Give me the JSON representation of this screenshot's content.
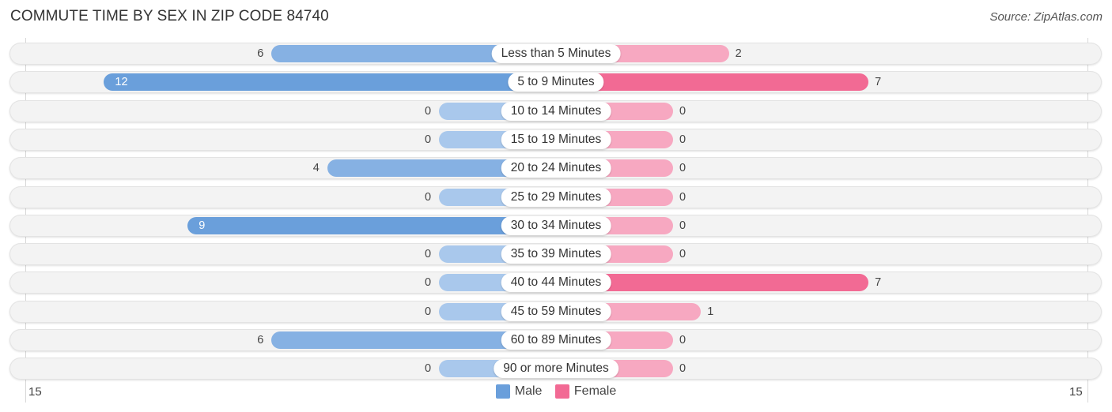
{
  "header": {
    "title": "COMMUTE TIME BY SEX IN ZIP CODE 84740",
    "source": "Source: ZipAtlas.com"
  },
  "colors": {
    "male_strong": "#6a9fdb",
    "male_light": "#a9c8ec",
    "female_strong": "#f26a94",
    "female_light": "#f7a8c1"
  },
  "chart_data": {
    "type": "bar",
    "orientation": "horizontal-diverging",
    "title": "COMMUTE TIME BY SEX IN ZIP CODE 84740",
    "categories": [
      "Less than 5 Minutes",
      "5 to 9 Minutes",
      "10 to 14 Minutes",
      "15 to 19 Minutes",
      "20 to 24 Minutes",
      "25 to 29 Minutes",
      "30 to 34 Minutes",
      "35 to 39 Minutes",
      "40 to 44 Minutes",
      "45 to 59 Minutes",
      "60 to 89 Minutes",
      "90 or more Minutes"
    ],
    "series": [
      {
        "name": "Male",
        "values": [
          6,
          12,
          0,
          0,
          4,
          0,
          9,
          0,
          0,
          0,
          6,
          0
        ]
      },
      {
        "name": "Female",
        "values": [
          2,
          7,
          0,
          0,
          0,
          0,
          0,
          0,
          7,
          1,
          0,
          0
        ]
      }
    ],
    "axis": {
      "left_tick": "15",
      "right_tick": "15",
      "range": [
        0,
        15
      ]
    },
    "legend": {
      "position": "bottom-center",
      "items": [
        "Male",
        "Female"
      ]
    }
  }
}
